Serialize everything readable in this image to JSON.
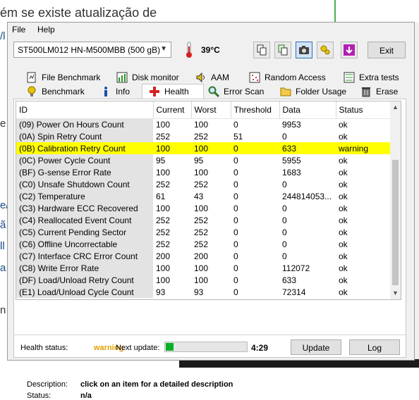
{
  "background": {
    "heading": "ém se existe atualização de",
    "fragments": [
      "/l",
      "e",
      "e/",
      "ã",
      "ll",
      "a",
      "n"
    ]
  },
  "menu": {
    "file": "File",
    "help": "Help"
  },
  "toolbar": {
    "drive": "ST500LM012 HN-M500MBB (500 gB)",
    "temperature": "39°C",
    "exit_label": "Exit"
  },
  "tabs_row1": [
    {
      "label": "File Benchmark",
      "icon": "file-benchmark-icon"
    },
    {
      "label": "Disk monitor",
      "icon": "disk-monitor-icon"
    },
    {
      "label": "AAM",
      "icon": "speaker-icon"
    },
    {
      "label": "Random Access",
      "icon": "random-access-icon"
    },
    {
      "label": "Extra tests",
      "icon": "extra-tests-icon"
    }
  ],
  "tabs_row2": [
    {
      "label": "Benchmark",
      "icon": "benchmark-icon"
    },
    {
      "label": "Info",
      "icon": "info-icon"
    },
    {
      "label": "Health",
      "icon": "health-icon"
    },
    {
      "label": "Error Scan",
      "icon": "error-scan-icon"
    },
    {
      "label": "Folder Usage",
      "icon": "folder-icon"
    },
    {
      "label": "Erase",
      "icon": "erase-icon"
    }
  ],
  "table": {
    "columns": [
      "ID",
      "Current",
      "Worst",
      "Threshold",
      "Data",
      "Status"
    ],
    "rows": [
      [
        "(09) Power On Hours Count",
        "100",
        "100",
        "0",
        "9953",
        "ok"
      ],
      [
        "(0A) Spin Retry Count",
        "252",
        "252",
        "51",
        "0",
        "ok"
      ],
      [
        "(0B) Calibration Retry Count",
        "100",
        "100",
        "0",
        "633",
        "warning"
      ],
      [
        "(0C) Power Cycle Count",
        "95",
        "95",
        "0",
        "5955",
        "ok"
      ],
      [
        "(BF) G-sense Error Rate",
        "100",
        "100",
        "0",
        "1683",
        "ok"
      ],
      [
        "(C0) Unsafe Shutdown Count",
        "252",
        "252",
        "0",
        "0",
        "ok"
      ],
      [
        "(C2) Temperature",
        "61",
        "43",
        "0",
        "244814053...",
        "ok"
      ],
      [
        "(C3) Hardware ECC Recovered",
        "100",
        "100",
        "0",
        "0",
        "ok"
      ],
      [
        "(C4) Reallocated Event Count",
        "252",
        "252",
        "0",
        "0",
        "ok"
      ],
      [
        "(C5) Current Pending Sector",
        "252",
        "252",
        "0",
        "0",
        "ok"
      ],
      [
        "(C6) Offline Uncorrectable",
        "252",
        "252",
        "0",
        "0",
        "ok"
      ],
      [
        "(C7) Interface CRC Error Count",
        "200",
        "200",
        "0",
        "0",
        "ok"
      ],
      [
        "(C8) Write Error Rate",
        "100",
        "100",
        "0",
        "112072",
        "ok"
      ],
      [
        "(DF) Load/Unload Retry Count",
        "100",
        "100",
        "0",
        "633",
        "ok"
      ],
      [
        "(E1) Load/Unload Cycle Count",
        "93",
        "93",
        "0",
        "72314",
        "ok"
      ]
    ],
    "warning_row_index": 2
  },
  "details": {
    "description_label": "Description:",
    "description_text": "click on an item for a detailed description",
    "status_label": "Status:",
    "status_text": "n/a"
  },
  "footer": {
    "health_label": "Health status:",
    "health_value": "warning",
    "next_update_label": "Next update:",
    "next_update_time": "4:29",
    "progress_fraction": 0.1,
    "update_button": "Update",
    "log_button": "Log"
  },
  "colors": {
    "warning_row": "#ffff00",
    "health_warning": "#e3a000",
    "progress": "#06b025",
    "selected_button": "#2f6fbf"
  }
}
